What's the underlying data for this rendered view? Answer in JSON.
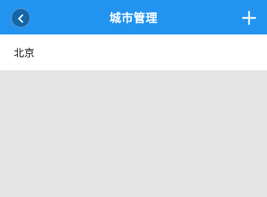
{
  "header": {
    "title": "城市管理",
    "back_icon": "chevron-left-icon",
    "add_icon": "plus-icon"
  },
  "cities": [
    {
      "name": "北京"
    }
  ],
  "colors": {
    "header_bg": "#2294f0",
    "back_button_bg": "#1566a8",
    "page_bg": "#e4e4e4",
    "list_bg": "#ffffff"
  }
}
